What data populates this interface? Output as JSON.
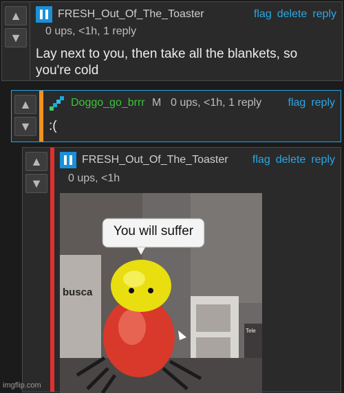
{
  "comments": [
    {
      "username": "FRESH_Out_Of_The_Toaster",
      "meta": "0 ups, <1h, 1 reply",
      "text_line1": "Lay next to you, then take all the blankets, so",
      "text_line2": "you're cold",
      "links": [
        "flag",
        "delete",
        "reply"
      ]
    },
    {
      "username": "Doggo_go_brrr",
      "badge": "M",
      "meta": "0 ups, <1h, 1 reply",
      "text": ":(",
      "links": [
        "flag",
        "reply"
      ]
    },
    {
      "username": "FRESH_Out_Of_The_Toaster",
      "meta": "0 ups, <1h",
      "links": [
        "flag",
        "delete",
        "reply"
      ],
      "meme": {
        "caption": "You will suffer",
        "sign_text": "busca",
        "small_sign": "Tele"
      }
    }
  ],
  "watermark": "imgflip.com",
  "icons": {
    "upvote": "upvote-arrow-icon",
    "downvote": "downvote-arrow-icon",
    "avatar_fresh": "pause-bars-avatar-icon",
    "avatar_doggo": "pixel-diagonal-avatar-icon"
  },
  "colors": {
    "link": "#2ba7e6",
    "username_doggo": "#3cc43c",
    "avatar_fresh": "#1a90d9",
    "orange_bar": "#f0921e",
    "red_bar": "#e03030",
    "comment_border_highlight": "#2aa4e0"
  }
}
